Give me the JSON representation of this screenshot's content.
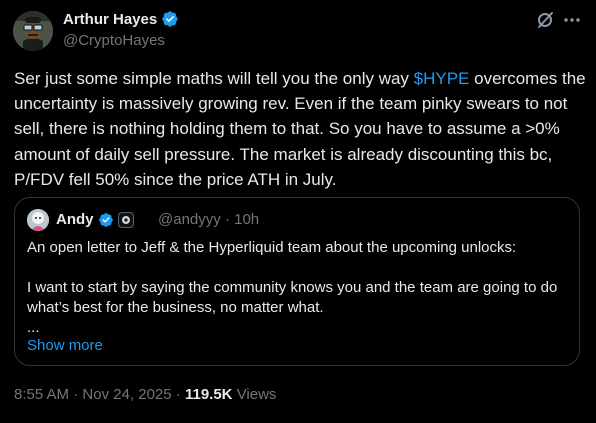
{
  "author": {
    "name": "Arthur Hayes",
    "handle": "@CryptoHayes",
    "verified": true
  },
  "tweet": {
    "text_before": "Ser just some simple maths will tell you the only way ",
    "cashtag": "$HYPE",
    "text_after": " overcomes the uncertainty is massively growing rev. Even if the team pinky swears to not sell, there is nothing holding them to that. So you have to assume a >0% amount of daily sell pressure. The market is already discounting this bc, P/FDV fell 50% since the price ATH in July."
  },
  "quote": {
    "name": "Andy",
    "handle": "@andyyy",
    "time": "10h",
    "separator": "·",
    "paragraph1": "An open letter to Jeff & the Hyperliquid team about the upcoming unlocks:",
    "paragraph2": "I want to start by saying the community knows you and the team are going to do what’s best for the business, no matter what.",
    "ellipsis": "...",
    "show_more": "Show more"
  },
  "footer": {
    "time": "8:55 AM",
    "date": "Nov 24, 2025",
    "separator": "·",
    "views_count": "119.5K",
    "views_label": "Views"
  },
  "icons": {
    "verified": "verified-badge-icon",
    "grok": "grok-icon",
    "more": "more-options-icon",
    "affiliate": "affiliate-badge-icon"
  },
  "colors": {
    "background": "#000000",
    "text": "#e7e9ea",
    "secondary": "#71767b",
    "accent": "#1d9bf0",
    "border": "#2f3336"
  }
}
